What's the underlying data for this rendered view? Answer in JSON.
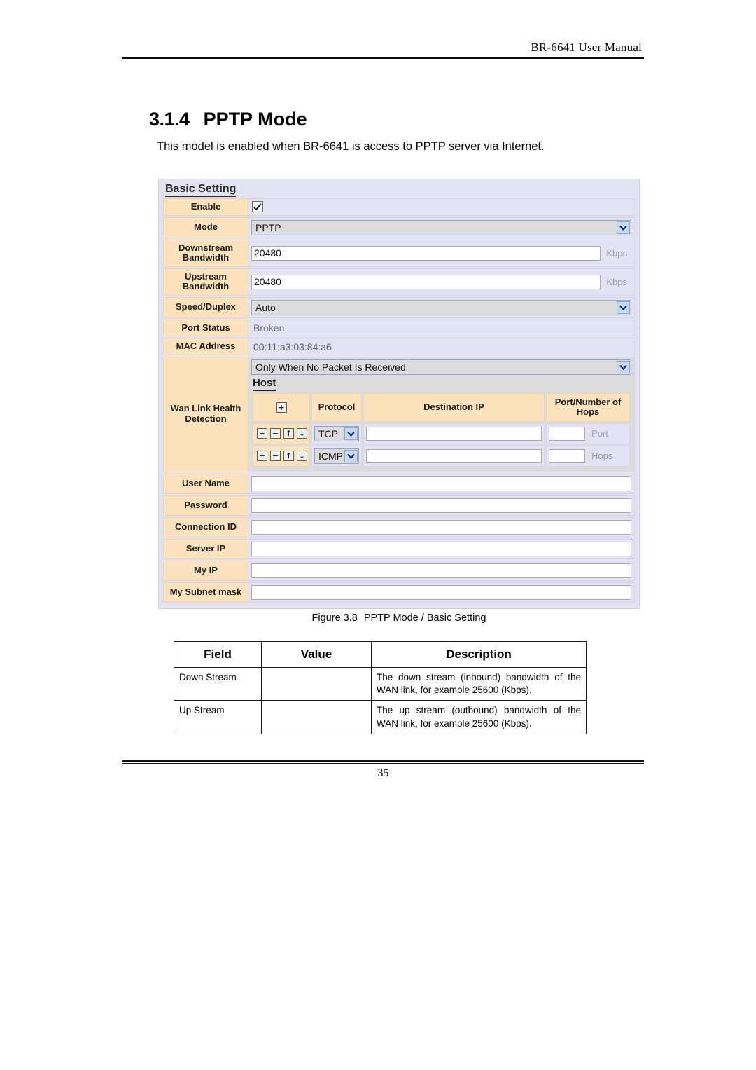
{
  "header": {
    "manual_title": "BR-6641 User Manual"
  },
  "heading": {
    "number": "3.1.4",
    "title": "PPTP Mode"
  },
  "intro": "This model is enabled when BR-6641 is access to PPTP server via Internet.",
  "panel": {
    "title": "Basic Setting",
    "labels": {
      "enable": "Enable",
      "mode": "Mode",
      "downstream_bandwidth": "Downstream Bandwidth",
      "upstream_bandwidth": "Upstream Bandwidth",
      "speed_duplex": "Speed/Duplex",
      "port_status": "Port Status",
      "mac_address": "MAC Address",
      "wan_link_health_detection": "Wan Link Health Detection",
      "user_name": "User Name",
      "password": "Password",
      "connection_id": "Connection ID",
      "server_ip": "Server IP",
      "my_ip": "My IP",
      "my_subnet_mask": "My Subnet mask"
    },
    "values": {
      "enable_checked": "checked",
      "mode": "PPTP",
      "downstream_bandwidth": "20480",
      "downstream_unit": "Kbps",
      "upstream_bandwidth": "20480",
      "upstream_unit": "Kbps",
      "speed_duplex": "Auto",
      "port_status": "Broken",
      "mac_address": "00:11:a3:03:84:a6",
      "wan_link_detection": "Only When No Packet Is Received",
      "user_name": "",
      "password": "",
      "connection_id": "",
      "server_ip": "",
      "my_ip": "",
      "my_subnet_mask": ""
    },
    "host": {
      "title": "Host",
      "columns": [
        "＋",
        "Protocol",
        "Destination IP",
        "Port/Number of Hops"
      ],
      "add_row_button": "+",
      "rows": [
        {
          "actions": [
            "+",
            "−",
            "↑",
            "↓"
          ],
          "protocol": "TCP",
          "destination_ip": "",
          "port_value": "",
          "port_placeholder": "Port"
        },
        {
          "actions": [
            "+",
            "−",
            "↑",
            "↓"
          ],
          "protocol": "ICMP",
          "destination_ip": "",
          "port_value": "",
          "port_placeholder": "Hops"
        }
      ]
    }
  },
  "figure_caption": {
    "label": "Figure 3.8",
    "text": "PPTP Mode / Basic Setting"
  },
  "desc_table": {
    "headers": [
      "Field",
      "Value",
      "Description"
    ],
    "rows": [
      {
        "field": "Down Stream",
        "value": "",
        "description": "The down stream (inbound) bandwidth of the WAN link, for example 25600 (Kbps)."
      },
      {
        "field": "Up Stream",
        "value": "",
        "description": "The up stream (outbound) bandwidth of the WAN link, for example 25600 (Kbps)."
      }
    ]
  },
  "footer": {
    "page_number": "35"
  },
  "colors": {
    "label_bg": "#fde3bd",
    "panel_bg": "#e3e3f4",
    "select_bg": "#dcdcdc",
    "arrow_bg": "#c7d8f2"
  }
}
